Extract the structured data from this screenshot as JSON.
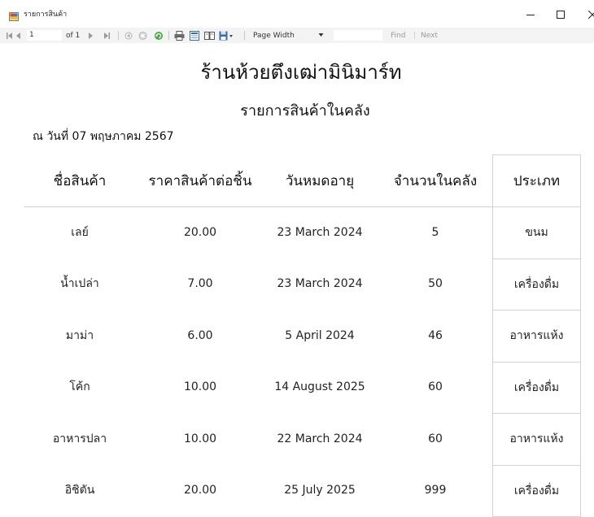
{
  "window": {
    "title": "รายการสินค้า",
    "icons": {
      "app": "report-app-icon",
      "minimize": "minimize-icon",
      "maximize": "maximize-icon",
      "close": "close-icon"
    }
  },
  "toolbar": {
    "current_page": "1",
    "page_of": "of 1",
    "zoom": "Page Width",
    "find_label": "Find",
    "find_separator": "|",
    "next_label": "Next",
    "icons": [
      "first-page-icon",
      "previous-page-icon",
      "next-page-icon",
      "last-page-icon",
      "back-icon",
      "stop-icon",
      "refresh-icon",
      "print-icon",
      "print-layout-icon",
      "page-setup-icon",
      "export-icon"
    ]
  },
  "report": {
    "store_name": "ร้านห้วยตึงเฒ่ามินิมาร์ท",
    "title": "รายการสินค้าในคลัง",
    "date_line": "ณ วันที่ 07 พฤษภาคม 2567",
    "columns": [
      "ชื่อสินค้า",
      "ราคาสินค้าต่อชิ้น",
      "วันหมดอายุ",
      "จำนวนในคลัง",
      "ประเภท"
    ],
    "rows": [
      {
        "name": "เลย์",
        "price": "20.00",
        "expiry": "23 March 2024",
        "qty": "5",
        "type": "ขนม"
      },
      {
        "name": "น้ำเปล่า",
        "price": "7.00",
        "expiry": "23 March 2024",
        "qty": "50",
        "type": "เครื่องดื่ม"
      },
      {
        "name": "มาม่า",
        "price": "6.00",
        "expiry": "5 April 2024",
        "qty": "46",
        "type": "อาหารแห้ง"
      },
      {
        "name": "โค้ก",
        "price": "10.00",
        "expiry": "14 August 2025",
        "qty": "60",
        "type": "เครื่องดื่ม"
      },
      {
        "name": "อาหารปลา",
        "price": "10.00",
        "expiry": "22 March 2024",
        "qty": "60",
        "type": "อาหารแห้ง"
      },
      {
        "name": "อิชิตัน",
        "price": "20.00",
        "expiry": "25 July 2025",
        "qty": "999",
        "type": "เครื่องดื่ม"
      }
    ]
  }
}
